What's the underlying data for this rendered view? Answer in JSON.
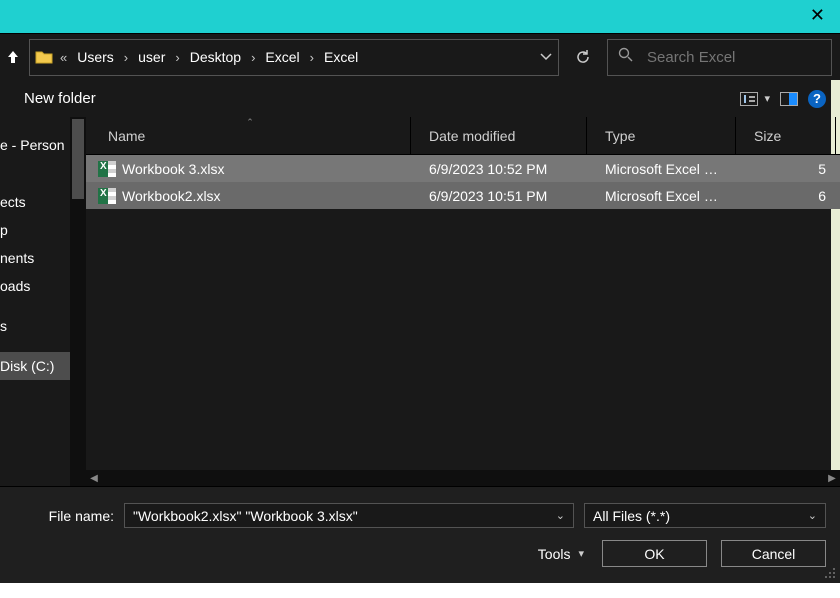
{
  "titlebar": {
    "close_glyph": "✕"
  },
  "addr": {
    "ellipsis": "«",
    "crumbs": [
      "Users",
      "user",
      "Desktop",
      "Excel",
      "Excel"
    ]
  },
  "search": {
    "placeholder": "Search Excel"
  },
  "subbar": {
    "new_folder": "New folder",
    "help": "?"
  },
  "columns": {
    "name": "Name",
    "date": "Date modified",
    "type": "Type",
    "size": "Size"
  },
  "files": [
    {
      "name": "Workbook 3.xlsx",
      "date": "6/9/2023 10:52 PM",
      "type": "Microsoft Excel W...",
      "size": "5"
    },
    {
      "name": "Workbook2.xlsx",
      "date": "6/9/2023 10:51 PM",
      "type": "Microsoft Excel W...",
      "size": "6"
    }
  ],
  "sidebar": {
    "items": [
      "e - Person",
      "ects",
      "p",
      "nents",
      "oads",
      "",
      "s",
      "",
      " Disk (C:)"
    ]
  },
  "bottom": {
    "filename_label": "File name:",
    "filename_value": "\"Workbook2.xlsx\" \"Workbook 3.xlsx\"",
    "filter": "All Files (*.*)",
    "tools": "Tools",
    "ok": "OK",
    "cancel": "Cancel"
  },
  "side_letter": "s"
}
